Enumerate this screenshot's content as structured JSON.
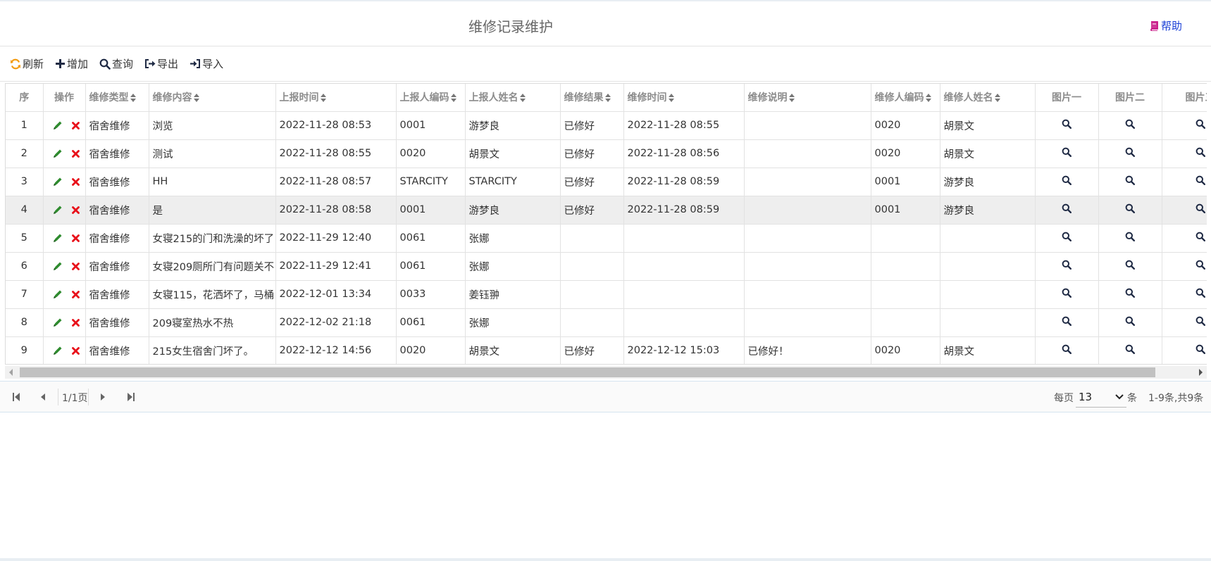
{
  "header": {
    "title": "维修记录维护",
    "help_label": "帮助"
  },
  "toolbar": {
    "refresh_label": "刷新",
    "add_label": "增加",
    "query_label": "查询",
    "export_label": "导出",
    "import_label": "导入"
  },
  "table": {
    "columns": {
      "seq": "序",
      "ops": "操作",
      "type": "维修类型",
      "content": "维修内容",
      "report_time": "上报时间",
      "reporter_code": "上报人编码",
      "reporter_name": "上报人姓名",
      "result": "维修结果",
      "repair_time": "维修时间",
      "description": "维修说明",
      "repairer_code": "维修人编码",
      "repairer_name": "维修人姓名",
      "img1": "图片一",
      "img2": "图片二",
      "img3": "图片三"
    },
    "rows": [
      {
        "seq": "1",
        "type": "宿舍维修",
        "content": "浏览",
        "report_time": "2022-11-28 08:53",
        "reporter_code": "0001",
        "reporter_name": "游梦良",
        "result": "已修好",
        "repair_time": "2022-11-28 08:55",
        "description": "",
        "repairer_code": "0020",
        "repairer_name": "胡景文"
      },
      {
        "seq": "2",
        "type": "宿舍维修",
        "content": "测试",
        "report_time": "2022-11-28 08:55",
        "reporter_code": "0020",
        "reporter_name": "胡景文",
        "result": "已修好",
        "repair_time": "2022-11-28 08:56",
        "description": "",
        "repairer_code": "0020",
        "repairer_name": "胡景文"
      },
      {
        "seq": "3",
        "type": "宿舍维修",
        "content": "HH",
        "report_time": "2022-11-28 08:57",
        "reporter_code": "STARCITY",
        "reporter_name": "STARCITY",
        "result": "已修好",
        "repair_time": "2022-11-28 08:59",
        "description": "",
        "repairer_code": "0001",
        "repairer_name": "游梦良"
      },
      {
        "seq": "4",
        "type": "宿舍维修",
        "content": "是",
        "report_time": "2022-11-28 08:58",
        "reporter_code": "0001",
        "reporter_name": "游梦良",
        "result": "已修好",
        "repair_time": "2022-11-28 08:59",
        "description": "",
        "repairer_code": "0001",
        "repairer_name": "游梦良"
      },
      {
        "seq": "5",
        "type": "宿舍维修",
        "content": "女寝215的门和洗澡的坏了",
        "report_time": "2022-11-29 12:40",
        "reporter_code": "0061",
        "reporter_name": "张娜",
        "result": "",
        "repair_time": "",
        "description": "",
        "repairer_code": "",
        "repairer_name": ""
      },
      {
        "seq": "6",
        "type": "宿舍维修",
        "content": "女寝209厕所门有问题关不",
        "report_time": "2022-11-29 12:41",
        "reporter_code": "0061",
        "reporter_name": "张娜",
        "result": "",
        "repair_time": "",
        "description": "",
        "repairer_code": "",
        "repairer_name": ""
      },
      {
        "seq": "7",
        "type": "宿舍维修",
        "content": "女寝115，花洒坏了，马桶",
        "report_time": "2022-12-01 13:34",
        "reporter_code": "0033",
        "reporter_name": "姜钰翀",
        "result": "",
        "repair_time": "",
        "description": "",
        "repairer_code": "",
        "repairer_name": ""
      },
      {
        "seq": "8",
        "type": "宿舍维修",
        "content": "209寝室热水不热",
        "report_time": "2022-12-02 21:18",
        "reporter_code": "0061",
        "reporter_name": "张娜",
        "result": "",
        "repair_time": "",
        "description": "",
        "repairer_code": "",
        "repairer_name": ""
      },
      {
        "seq": "9",
        "type": "宿舍维修",
        "content": "215女生宿舍门坏了。",
        "report_time": "2022-12-12 14:56",
        "reporter_code": "0020",
        "reporter_name": "胡景文",
        "result": "已修好",
        "repair_time": "2022-12-12 15:03",
        "description": "已修好！",
        "repairer_code": "0020",
        "repairer_name": "胡景文"
      }
    ]
  },
  "pager": {
    "page_label": "1/1页",
    "per_page_label": "每页",
    "per_page_value": "13",
    "unit_label": "条",
    "summary": "1-9条,共9条"
  },
  "icons": {
    "refresh": "refresh-icon",
    "add": "plus-icon",
    "query": "search-icon",
    "export": "export-icon",
    "import": "import-icon",
    "help": "book-icon",
    "edit": "pencil-icon",
    "delete": "close-icon",
    "view": "search-icon"
  },
  "colors": {
    "accent_orange": "#f39c12",
    "edit_green": "#2e8b2e",
    "delete_red": "#e8101a",
    "help_magenta": "#c71585",
    "link_blue": "#1a3fd6"
  }
}
